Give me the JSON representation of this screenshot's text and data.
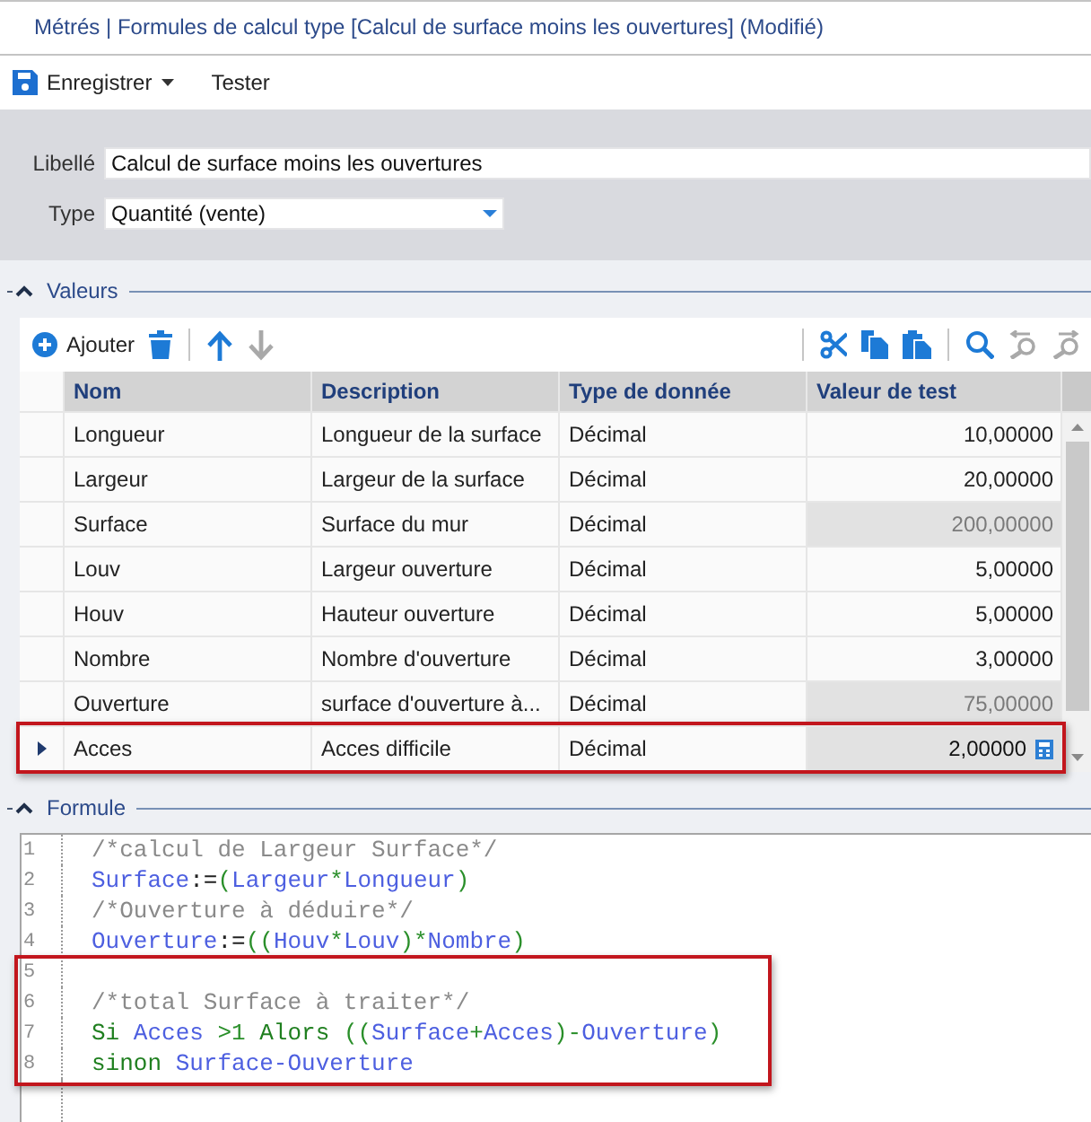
{
  "window": {
    "title": "Métrés | Formules de calcul type [Calcul de surface moins les ouvertures] (Modifié)"
  },
  "toolbar": [
    {
      "kind": "save-split",
      "label": "Enregistrer"
    },
    {
      "kind": "plain",
      "label": "Tester"
    }
  ],
  "form": [
    {
      "kind": "text",
      "label": "Libellé",
      "value": "Calcul de surface moins les ouvertures"
    },
    {
      "kind": "dropdown",
      "label": "Type",
      "value": "Quantité (vente)"
    }
  ],
  "values": {
    "title": "Valeurs",
    "expanded": true,
    "tools_left": [
      {
        "tools": [
          {
            "kind": "add",
            "label": "Ajouter",
            "disabled": false
          },
          {
            "kind": "delete",
            "disabled": false
          }
        ]
      },
      {
        "tools": [
          {
            "kind": "move-up",
            "disabled": false
          },
          {
            "kind": "move-down",
            "disabled": true
          }
        ]
      }
    ],
    "tools_right": [
      {
        "tools": [
          {
            "kind": "cut",
            "disabled": false
          },
          {
            "kind": "copy",
            "disabled": false
          },
          {
            "kind": "paste",
            "disabled": false
          }
        ]
      },
      {
        "tools": [
          {
            "kind": "find",
            "disabled": false
          },
          {
            "kind": "find-previous",
            "disabled": true
          },
          {
            "kind": "find-next",
            "disabled": true
          }
        ]
      }
    ],
    "table": {
      "columns": [
        "Nom",
        "Description",
        "Type de donnée",
        "Valeur de test"
      ],
      "rows": [
        {
          "cells": [
            "Longueur",
            "Longueur de la surface",
            "Décimal",
            "10,00000"
          ],
          "computed": false,
          "selected": false,
          "highlighted": false
        },
        {
          "cells": [
            "Largeur",
            "Largeur de la surface",
            "Décimal",
            "20,00000"
          ],
          "computed": false,
          "selected": false,
          "highlighted": false
        },
        {
          "cells": [
            "Surface",
            "Surface du mur",
            "Décimal",
            "200,00000"
          ],
          "computed": true,
          "selected": false,
          "highlighted": false
        },
        {
          "cells": [
            "Louv",
            "Largeur ouverture",
            "Décimal",
            "5,00000"
          ],
          "computed": false,
          "selected": false,
          "highlighted": false
        },
        {
          "cells": [
            "Houv",
            "Hauteur ouverture",
            "Décimal",
            "5,00000"
          ],
          "computed": false,
          "selected": false,
          "highlighted": false
        },
        {
          "cells": [
            "Nombre",
            "Nombre d'ouverture",
            "Décimal",
            "3,00000"
          ],
          "computed": false,
          "selected": false,
          "highlighted": false
        },
        {
          "cells": [
            "Ouverture",
            "surface d'ouverture à...",
            "Décimal",
            "75,00000"
          ],
          "computed": true,
          "selected": false,
          "highlighted": false
        },
        {
          "cells": [
            "Acces",
            "Acces difficile",
            "Décimal",
            "2,00000"
          ],
          "computed": false,
          "selected": true,
          "highlighted": true
        }
      ]
    }
  },
  "formula": {
    "title": "Formule",
    "expanded": true,
    "lines": [
      {
        "number": "1",
        "tokens": [
          {
            "kind": "comment",
            "text": "/*calcul de Largeur Surface*/"
          }
        ],
        "highlighted": false
      },
      {
        "number": "2",
        "tokens": [
          {
            "kind": "identifier",
            "text": "Surface"
          },
          {
            "kind": "assign",
            "text": ":="
          },
          {
            "kind": "operator",
            "text": "("
          },
          {
            "kind": "identifier",
            "text": "Largeur"
          },
          {
            "kind": "operator",
            "text": "*"
          },
          {
            "kind": "identifier",
            "text": "Longueur"
          },
          {
            "kind": "operator",
            "text": ")"
          }
        ],
        "highlighted": false
      },
      {
        "number": "3",
        "tokens": [
          {
            "kind": "comment",
            "text": "/*Ouverture à déduire*/"
          }
        ],
        "highlighted": false
      },
      {
        "number": "4",
        "tokens": [
          {
            "kind": "identifier",
            "text": "Ouverture"
          },
          {
            "kind": "assign",
            "text": ":="
          },
          {
            "kind": "operator",
            "text": "(("
          },
          {
            "kind": "identifier",
            "text": "Houv"
          },
          {
            "kind": "operator",
            "text": "*"
          },
          {
            "kind": "identifier",
            "text": "Louv"
          },
          {
            "kind": "operator",
            "text": ")*"
          },
          {
            "kind": "identifier",
            "text": "Nombre"
          },
          {
            "kind": "operator",
            "text": ")"
          }
        ],
        "highlighted": false
      },
      {
        "number": "5",
        "highlighted": true
      },
      {
        "number": "6",
        "tokens": [
          {
            "kind": "comment",
            "text": "/*total Surface à traiter*/"
          }
        ],
        "highlighted": true
      },
      {
        "number": "7",
        "tokens": [
          {
            "kind": "keyword",
            "text": "Si"
          },
          {
            "kind": "identifier",
            "text": " Acces"
          },
          {
            "kind": "operator",
            "text": " >1"
          },
          {
            "kind": "keyword",
            "text": " Alors"
          },
          {
            "kind": "operator",
            "text": " (("
          },
          {
            "kind": "identifier",
            "text": "Surface"
          },
          {
            "kind": "operator",
            "text": "+"
          },
          {
            "kind": "identifier",
            "text": "Acces"
          },
          {
            "kind": "operator",
            "text": ")-"
          },
          {
            "kind": "identifier",
            "text": "Ouverture"
          },
          {
            "kind": "operator",
            "text": ")"
          }
        ],
        "highlighted": true
      },
      {
        "number": "8",
        "tokens": [
          {
            "kind": "keyword",
            "text": "sinon"
          },
          {
            "kind": "identifier",
            "text": " Surface-Ouverture"
          }
        ],
        "highlighted": true
      }
    ]
  }
}
